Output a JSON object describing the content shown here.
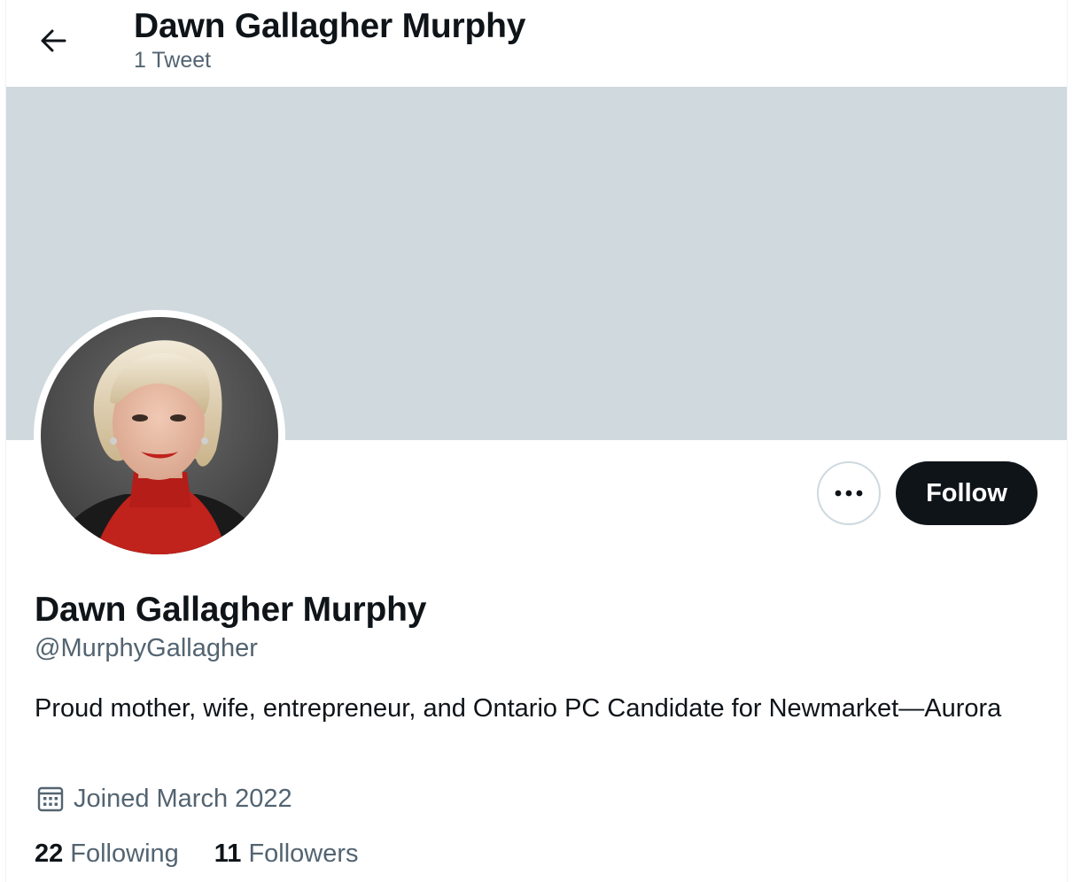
{
  "header": {
    "title": "Dawn Gallagher Murphy",
    "subtitle": "1 Tweet"
  },
  "actions": {
    "follow_label": "Follow"
  },
  "profile": {
    "name": "Dawn Gallagher Murphy",
    "handle": "@MurphyGallagher",
    "bio": "Proud mother, wife, entrepreneur, and Ontario PC Candidate for Newmarket—Aurora",
    "joined": "Joined March 2022"
  },
  "stats": {
    "following_count": "22",
    "following_label": "Following",
    "followers_count": "11",
    "followers_label": "Followers"
  },
  "colors": {
    "banner": "#cfd9de",
    "text_primary": "#0f1419",
    "text_secondary": "#536471",
    "follow_button_bg": "#0f1419"
  },
  "icons": {
    "back": "arrow-left-icon",
    "more": "more-horizontal-icon",
    "calendar": "calendar-icon"
  }
}
